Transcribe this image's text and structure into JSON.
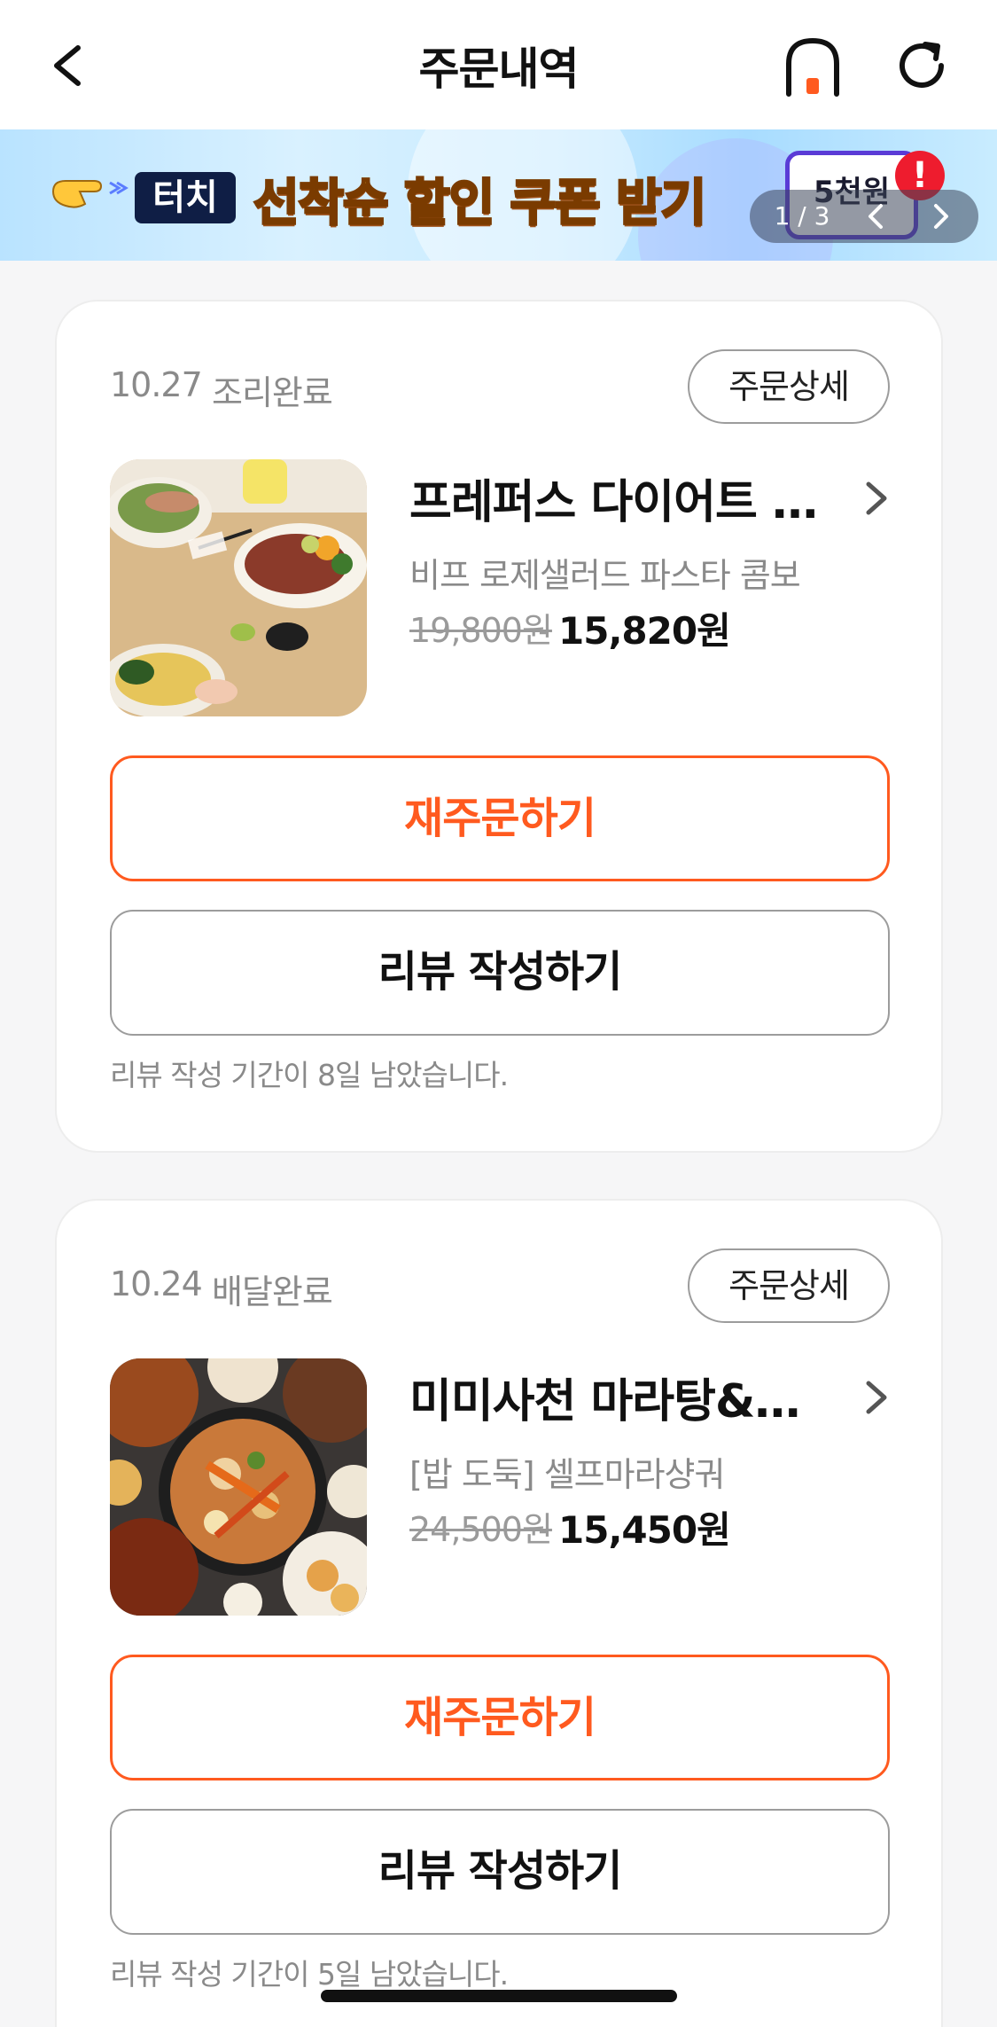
{
  "header": {
    "title": "주문내역",
    "icons": {
      "back": "back-arrow-icon",
      "home": "home-icon",
      "refresh": "refresh-icon"
    },
    "home_dot_color": "#ff5a1f"
  },
  "banner": {
    "badge": "터치",
    "headline": "선착순 할인 쿠폰 받기",
    "coupon_text": "5천원",
    "alert_mark": "!",
    "pager": {
      "current": "1",
      "total": "3",
      "text": "1 / 3"
    }
  },
  "orders": [
    {
      "date": "10.27",
      "status": "조리완료",
      "detail_label": "주문상세",
      "store": "프레퍼스 다이어트 푸드",
      "menu": "비프 로제샐러드 파스타 콤보",
      "original_price": "19,800원",
      "final_price": "15,820원",
      "reorder_label": "재주문하기",
      "review_label": "리뷰 작성하기",
      "review_note": "리뷰 작성 기간이 8일 남았습니다."
    },
    {
      "date": "10.24",
      "status": "배달완료",
      "detail_label": "주문상세",
      "store": "미미사천 마라탕&마라샹궈",
      "menu": "[밥 도둑] 셀프마라샹궈",
      "original_price": "24,500원",
      "final_price": "15,450원",
      "reorder_label": "재주문하기",
      "review_label": "리뷰 작성하기",
      "review_note": "리뷰 작성 기간이 5일 남았습니다."
    }
  ],
  "colors": {
    "accent": "#ff5a1f",
    "text": "#111111",
    "muted": "#8a8a8a",
    "background": "#f6f6f7"
  }
}
